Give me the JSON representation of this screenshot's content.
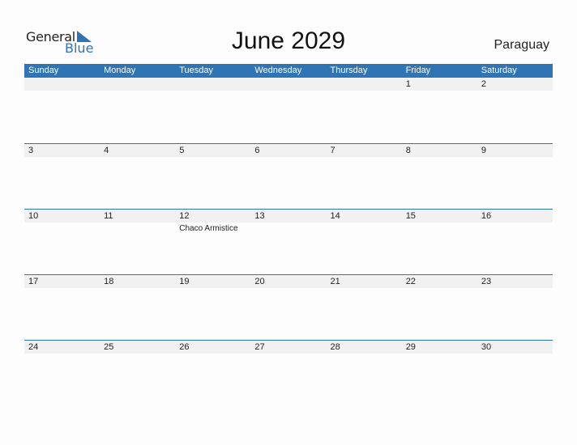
{
  "logo": {
    "general": "General",
    "blue": "Blue"
  },
  "title": "June 2029",
  "country": "Paraguay",
  "colors": {
    "accent": "#2f74b5",
    "strip": "#f1f1f1"
  },
  "weekdays": [
    "Sunday",
    "Monday",
    "Tuesday",
    "Wednesday",
    "Thursday",
    "Friday",
    "Saturday"
  ],
  "weeks": [
    [
      "",
      "",
      "",
      "",
      "",
      "1",
      "2"
    ],
    [
      "3",
      "4",
      "5",
      "6",
      "7",
      "8",
      "9"
    ],
    [
      "10",
      "11",
      "12",
      "13",
      "14",
      "15",
      "16"
    ],
    [
      "17",
      "18",
      "19",
      "20",
      "21",
      "22",
      "23"
    ],
    [
      "24",
      "25",
      "26",
      "27",
      "28",
      "29",
      "30"
    ]
  ],
  "events": {
    "12": "Chaco Armistice"
  }
}
